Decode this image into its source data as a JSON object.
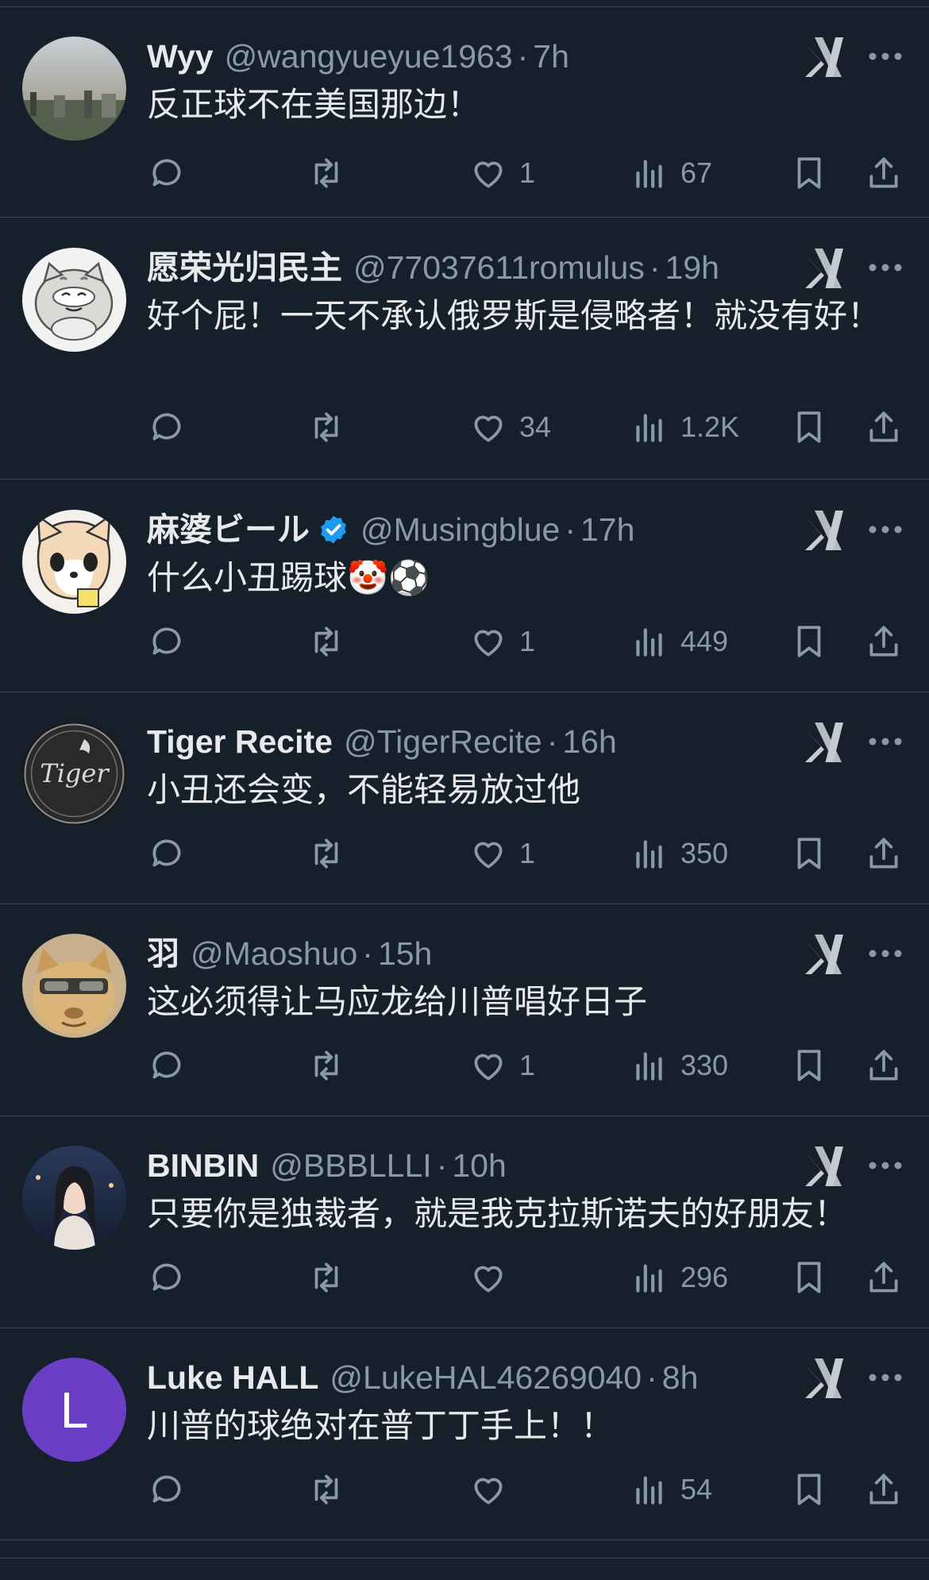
{
  "colors": {
    "background": "#15202b",
    "text": "#e7e9ea",
    "muted": "#8b98a5",
    "verified": "#1d9bf0",
    "avatar_purple": "#6a3fc6"
  },
  "tweets": [
    {
      "name": "Wyy",
      "handle": "@wangyueyue1963",
      "dot": "·",
      "time": "7h",
      "text": "反正球不在美国那边！",
      "likes": "1",
      "views": "67",
      "verified": false,
      "avatar": "photo-landscape"
    },
    {
      "name": "愿荣光归民主",
      "handle": "@77037611romulus",
      "dot": "·",
      "time": "19h",
      "text": "好个屁！一天不承认俄罗斯是侵略者！就没有好！",
      "likes": "34",
      "views": "1.2K",
      "verified": false,
      "avatar": "cartoon-cat"
    },
    {
      "name": "麻婆ビール",
      "handle": "@Musingblue",
      "dot": "·",
      "time": "17h",
      "text": "什么小丑踢球🤡⚽",
      "likes": "1",
      "views": "449",
      "verified": true,
      "avatar": "cartoon-fox"
    },
    {
      "name": "Tiger Recite",
      "handle": "@TigerRecite",
      "dot": "·",
      "time": "16h",
      "text": "小丑还会变，不能轻易放过他",
      "likes": "1",
      "views": "350",
      "verified": false,
      "avatar": "tiger-logo",
      "avatar_text": "Tiger"
    },
    {
      "name": "羽",
      "handle": "@Maoshuo",
      "dot": "·",
      "time": "15h",
      "text": "这必须得让马应龙给川普唱好日子",
      "likes": "1",
      "views": "330",
      "verified": false,
      "avatar": "cat-sunglasses"
    },
    {
      "name": "BINBIN",
      "handle": "@BBBLLLI",
      "dot": "·",
      "time": "10h",
      "text": "只要你是独裁者，就是我克拉斯诺夫的好朋友！",
      "likes": "",
      "views": "296",
      "verified": false,
      "avatar": "photo-woman"
    },
    {
      "name": "Luke HALL",
      "handle": "@LukeHAL46269040",
      "dot": "·",
      "time": "8h",
      "text": "川普的球绝对在普丁丁手上！！",
      "likes": "",
      "views": "54",
      "verified": false,
      "avatar": "letter",
      "avatar_letter": "L"
    }
  ]
}
